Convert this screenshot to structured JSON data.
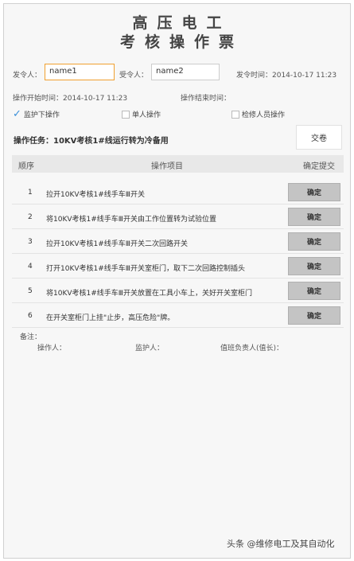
{
  "header": {
    "title_line1": "高压电工",
    "title_line2": "考核操作票"
  },
  "form": {
    "issuer_label": "发令人：",
    "issuer_value": "name1",
    "receiver_label": "受令人：",
    "receiver_value": "name2",
    "order_time": "发令时间：2014-10-17 11:23",
    "start_time": "操作开始时间：2014-10-17 11:23",
    "end_time": "操作结束时间："
  },
  "options": [
    {
      "label": "监护下操作",
      "checked": true
    },
    {
      "label": "单人操作",
      "checked": false
    },
    {
      "label": "检修人员操作",
      "checked": false
    }
  ],
  "task": {
    "text": "操作任务：10KV考核1#线运行转为冷备用",
    "submit_label": "交卷"
  },
  "table": {
    "headers": [
      "顺序",
      "操作项目",
      "确定提交"
    ],
    "rows": [
      {
        "num": "1",
        "text": "拉开10KV考核1#线手车Ⅲ开关",
        "btn": "确定"
      },
      {
        "num": "2",
        "text": "将10KV考核1#线手车Ⅲ开关由工作位置转为试验位置",
        "btn": "确定"
      },
      {
        "num": "3",
        "text": "拉开10KV考核1#线手车Ⅲ开关二次回路开关",
        "btn": "确定"
      },
      {
        "num": "4",
        "text": "打开10KV考核1#线手车Ⅲ开关室柜门，取下二次回路控制插头",
        "btn": "确定"
      },
      {
        "num": "5",
        "text": "将10KV考核1#线手车Ⅲ开关放置在工具小车上，关好开关室柜门",
        "btn": "确定"
      },
      {
        "num": "6",
        "text": "在开关室柜门上挂\"止步，高压危险\"牌。",
        "btn": "确定"
      }
    ]
  },
  "footer": {
    "remark": "备注：",
    "operator": "操作人：",
    "guardian": "监护人：",
    "duty_leader": "值班负责人(值长)："
  },
  "watermark": "头条 @维修电工及其自动化"
}
